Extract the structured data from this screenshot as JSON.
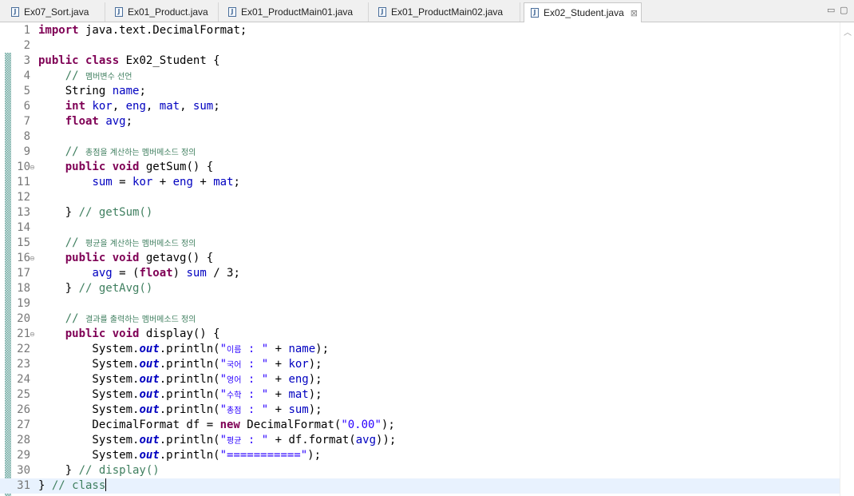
{
  "tabs": [
    {
      "label": "Ex07_Sort.java",
      "active": false
    },
    {
      "label": "Ex01_Product.java",
      "active": false
    },
    {
      "label": "Ex01_ProductMain01.java",
      "active": false
    },
    {
      "label": "Ex01_ProductMain02.java",
      "active": false
    },
    {
      "label": "Ex02_Student.java",
      "active": true
    }
  ],
  "tab_close_glyph": "⊠",
  "window_controls": {
    "minimize": "▭",
    "maximize": "▢"
  },
  "editor": {
    "current_line": 31,
    "fold_markers": [
      10,
      16,
      21
    ],
    "line_numbers": [
      "1",
      "2",
      "3",
      "4",
      "5",
      "6",
      "7",
      "8",
      "9",
      "10",
      "11",
      "12",
      "13",
      "14",
      "15",
      "16",
      "17",
      "18",
      "19",
      "20",
      "21",
      "22",
      "23",
      "24",
      "25",
      "26",
      "27",
      "28",
      "29",
      "30",
      "31"
    ],
    "lines": [
      {
        "n": 1,
        "tokens": [
          {
            "t": "kw",
            "v": "import"
          },
          {
            "t": "p",
            "v": " java.text.DecimalFormat;"
          }
        ]
      },
      {
        "n": 2,
        "tokens": []
      },
      {
        "n": 3,
        "tokens": [
          {
            "t": "kw",
            "v": "public"
          },
          {
            "t": "p",
            "v": " "
          },
          {
            "t": "kw",
            "v": "class"
          },
          {
            "t": "p",
            "v": " Ex02_Student {"
          }
        ]
      },
      {
        "n": 4,
        "tokens": [
          {
            "t": "p",
            "v": "    "
          },
          {
            "t": "cmt",
            "v": "// "
          },
          {
            "t": "cmt_ko",
            "v": "멤버변수 선언"
          }
        ]
      },
      {
        "n": 5,
        "tokens": [
          {
            "t": "p",
            "v": "    String "
          },
          {
            "t": "fld",
            "v": "name"
          },
          {
            "t": "p",
            "v": ";"
          }
        ]
      },
      {
        "n": 6,
        "tokens": [
          {
            "t": "p",
            "v": "    "
          },
          {
            "t": "kw",
            "v": "int"
          },
          {
            "t": "p",
            "v": " "
          },
          {
            "t": "fld",
            "v": "kor"
          },
          {
            "t": "p",
            "v": ", "
          },
          {
            "t": "fld",
            "v": "eng"
          },
          {
            "t": "p",
            "v": ", "
          },
          {
            "t": "fld",
            "v": "mat"
          },
          {
            "t": "p",
            "v": ", "
          },
          {
            "t": "fld",
            "v": "sum"
          },
          {
            "t": "p",
            "v": ";"
          }
        ]
      },
      {
        "n": 7,
        "tokens": [
          {
            "t": "p",
            "v": "    "
          },
          {
            "t": "kw",
            "v": "float"
          },
          {
            "t": "p",
            "v": " "
          },
          {
            "t": "fld",
            "v": "avg"
          },
          {
            "t": "p",
            "v": ";"
          }
        ]
      },
      {
        "n": 8,
        "tokens": []
      },
      {
        "n": 9,
        "tokens": [
          {
            "t": "p",
            "v": "    "
          },
          {
            "t": "cmt",
            "v": "// "
          },
          {
            "t": "cmt_ko",
            "v": "총점을 계산하는 멤버메소드 정의"
          }
        ]
      },
      {
        "n": 10,
        "tokens": [
          {
            "t": "p",
            "v": "    "
          },
          {
            "t": "kw",
            "v": "public"
          },
          {
            "t": "p",
            "v": " "
          },
          {
            "t": "kw",
            "v": "void"
          },
          {
            "t": "p",
            "v": " getSum() {"
          }
        ]
      },
      {
        "n": 11,
        "tokens": [
          {
            "t": "p",
            "v": "        "
          },
          {
            "t": "fld",
            "v": "sum"
          },
          {
            "t": "p",
            "v": " = "
          },
          {
            "t": "fld",
            "v": "kor"
          },
          {
            "t": "p",
            "v": " + "
          },
          {
            "t": "fld",
            "v": "eng"
          },
          {
            "t": "p",
            "v": " + "
          },
          {
            "t": "fld",
            "v": "mat"
          },
          {
            "t": "p",
            "v": ";"
          }
        ]
      },
      {
        "n": 12,
        "tokens": []
      },
      {
        "n": 13,
        "tokens": [
          {
            "t": "p",
            "v": "    } "
          },
          {
            "t": "cmt",
            "v": "// getSum()"
          }
        ]
      },
      {
        "n": 14,
        "tokens": []
      },
      {
        "n": 15,
        "tokens": [
          {
            "t": "p",
            "v": "    "
          },
          {
            "t": "cmt",
            "v": "// "
          },
          {
            "t": "cmt_ko",
            "v": "평균을 계산하는 멤버메소드 정의"
          }
        ]
      },
      {
        "n": 16,
        "tokens": [
          {
            "t": "p",
            "v": "    "
          },
          {
            "t": "kw",
            "v": "public"
          },
          {
            "t": "p",
            "v": " "
          },
          {
            "t": "kw",
            "v": "void"
          },
          {
            "t": "p",
            "v": " getavg() {"
          }
        ]
      },
      {
        "n": 17,
        "tokens": [
          {
            "t": "p",
            "v": "        "
          },
          {
            "t": "fld",
            "v": "avg"
          },
          {
            "t": "p",
            "v": " = ("
          },
          {
            "t": "kw",
            "v": "float"
          },
          {
            "t": "p",
            "v": ") "
          },
          {
            "t": "fld",
            "v": "sum"
          },
          {
            "t": "p",
            "v": " / 3;"
          }
        ]
      },
      {
        "n": 18,
        "tokens": [
          {
            "t": "p",
            "v": "    } "
          },
          {
            "t": "cmt",
            "v": "// getAvg()"
          }
        ]
      },
      {
        "n": 19,
        "tokens": []
      },
      {
        "n": 20,
        "tokens": [
          {
            "t": "p",
            "v": "    "
          },
          {
            "t": "cmt",
            "v": "// "
          },
          {
            "t": "cmt_ko",
            "v": "결과를 출력하는 멤버메소드 정의"
          }
        ]
      },
      {
        "n": 21,
        "tokens": [
          {
            "t": "p",
            "v": "    "
          },
          {
            "t": "kw",
            "v": "public"
          },
          {
            "t": "p",
            "v": " "
          },
          {
            "t": "kw",
            "v": "void"
          },
          {
            "t": "p",
            "v": " display() {"
          }
        ]
      },
      {
        "n": 22,
        "tokens": [
          {
            "t": "p",
            "v": "        System."
          },
          {
            "t": "sfld",
            "v": "out"
          },
          {
            "t": "p",
            "v": ".println("
          },
          {
            "t": "str",
            "v": "\""
          },
          {
            "t": "str_ko",
            "v": "이름"
          },
          {
            "t": "str",
            "v": " : \""
          },
          {
            "t": "p",
            "v": " + "
          },
          {
            "t": "fld",
            "v": "name"
          },
          {
            "t": "p",
            "v": ");"
          }
        ]
      },
      {
        "n": 23,
        "tokens": [
          {
            "t": "p",
            "v": "        System."
          },
          {
            "t": "sfld",
            "v": "out"
          },
          {
            "t": "p",
            "v": ".println("
          },
          {
            "t": "str",
            "v": "\""
          },
          {
            "t": "str_ko",
            "v": "국어"
          },
          {
            "t": "str",
            "v": " : \""
          },
          {
            "t": "p",
            "v": " + "
          },
          {
            "t": "fld",
            "v": "kor"
          },
          {
            "t": "p",
            "v": ");"
          }
        ]
      },
      {
        "n": 24,
        "tokens": [
          {
            "t": "p",
            "v": "        System."
          },
          {
            "t": "sfld",
            "v": "out"
          },
          {
            "t": "p",
            "v": ".println("
          },
          {
            "t": "str",
            "v": "\""
          },
          {
            "t": "str_ko",
            "v": "영어"
          },
          {
            "t": "str",
            "v": " : \""
          },
          {
            "t": "p",
            "v": " + "
          },
          {
            "t": "fld",
            "v": "eng"
          },
          {
            "t": "p",
            "v": ");"
          }
        ]
      },
      {
        "n": 25,
        "tokens": [
          {
            "t": "p",
            "v": "        System."
          },
          {
            "t": "sfld",
            "v": "out"
          },
          {
            "t": "p",
            "v": ".println("
          },
          {
            "t": "str",
            "v": "\""
          },
          {
            "t": "str_ko",
            "v": "수학"
          },
          {
            "t": "str",
            "v": " : \""
          },
          {
            "t": "p",
            "v": " + "
          },
          {
            "t": "fld",
            "v": "mat"
          },
          {
            "t": "p",
            "v": ");"
          }
        ]
      },
      {
        "n": 26,
        "tokens": [
          {
            "t": "p",
            "v": "        System."
          },
          {
            "t": "sfld",
            "v": "out"
          },
          {
            "t": "p",
            "v": ".println("
          },
          {
            "t": "str",
            "v": "\""
          },
          {
            "t": "str_ko",
            "v": "총점"
          },
          {
            "t": "str",
            "v": " : \""
          },
          {
            "t": "p",
            "v": " + "
          },
          {
            "t": "fld",
            "v": "sum"
          },
          {
            "t": "p",
            "v": ");"
          }
        ]
      },
      {
        "n": 27,
        "tokens": [
          {
            "t": "p",
            "v": "        DecimalFormat df = "
          },
          {
            "t": "kw",
            "v": "new"
          },
          {
            "t": "p",
            "v": " DecimalFormat("
          },
          {
            "t": "str",
            "v": "\"0.00\""
          },
          {
            "t": "p",
            "v": ");"
          }
        ]
      },
      {
        "n": 28,
        "tokens": [
          {
            "t": "p",
            "v": "        System."
          },
          {
            "t": "sfld",
            "v": "out"
          },
          {
            "t": "p",
            "v": ".println("
          },
          {
            "t": "str",
            "v": "\""
          },
          {
            "t": "str_ko",
            "v": "평균"
          },
          {
            "t": "str",
            "v": " : \""
          },
          {
            "t": "p",
            "v": " + df.format("
          },
          {
            "t": "fld",
            "v": "avg"
          },
          {
            "t": "p",
            "v": "));"
          }
        ]
      },
      {
        "n": 29,
        "tokens": [
          {
            "t": "p",
            "v": "        System."
          },
          {
            "t": "sfld",
            "v": "out"
          },
          {
            "t": "p",
            "v": ".println("
          },
          {
            "t": "str",
            "v": "\"===========\""
          },
          {
            "t": "p",
            "v": ");"
          }
        ]
      },
      {
        "n": 30,
        "tokens": [
          {
            "t": "p",
            "v": "    } "
          },
          {
            "t": "cmt",
            "v": "// display()"
          }
        ]
      },
      {
        "n": 31,
        "tokens": [
          {
            "t": "p",
            "v": "} "
          },
          {
            "t": "cmt",
            "v": "// class"
          }
        ]
      }
    ]
  },
  "colors": {
    "keyword": "#7f0055",
    "field": "#0000c0",
    "string": "#2a00ff",
    "comment": "#3f7f5f",
    "current_line_bg": "#e8f2fe",
    "change_bar": "#6fa6a0"
  },
  "icons": {
    "file": "java-file-icon",
    "fold": "fold-minus-icon",
    "scroll_up": "scroll-up-arrow-icon"
  }
}
